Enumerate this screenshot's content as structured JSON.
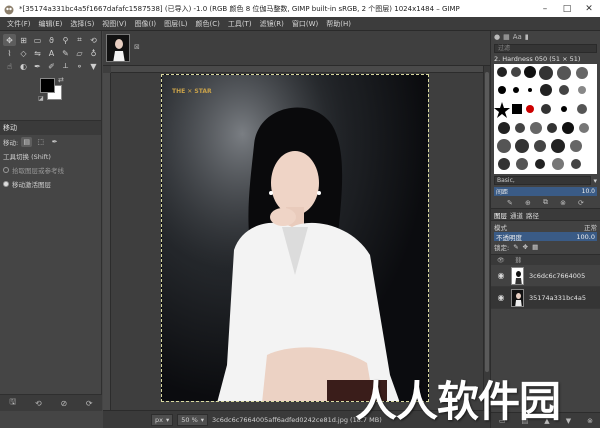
{
  "window": {
    "title": "*[35174a331bc4a5f1667dafafc1587538] (已导入) -1.0 (RGB 颜色 8 位伽马整数, GIMP built-in sRGB, 2 个图层) 1024x1484 – GIMP",
    "minimize_icon": "minimize-icon",
    "maximize_icon": "maximize-icon",
    "close_icon": "close-icon"
  },
  "menu": {
    "items": [
      "文件(F)",
      "编辑(E)",
      "选择(S)",
      "视图(V)",
      "图像(I)",
      "图层(L)",
      "颜色(C)",
      "工具(T)",
      "滤镜(R)",
      "窗口(W)",
      "帮助(H)"
    ]
  },
  "toolbox": {
    "tool_icons": [
      "move-icon",
      "align-icon",
      "rect-select-icon",
      "free-select-icon",
      "fuzzy-select-icon",
      "crop-icon",
      "transform-icon",
      "warp-icon",
      "perspective-icon",
      "flip-icon",
      "text-icon",
      "paintbrush-icon",
      "eraser-icon",
      "clone-icon",
      "smudge-icon",
      "dodge-icon",
      "path-icon",
      "color-picker-icon",
      "measure-icon",
      "zoom-icon",
      "bucket-fill-icon"
    ],
    "colors": {
      "foreground": "#000000",
      "background": "#ffffff"
    },
    "options": {
      "title": "移动",
      "move_label": "移动:",
      "tool_toggle_label": "工具切换 (Shift)",
      "option_pick": "拾取图层或参考线",
      "option_active": "移动激活图层"
    }
  },
  "canvas": {
    "watermark_logo_text": "THE STAR",
    "status": {
      "unit": "px",
      "zoom": "50 %",
      "info": "3c6dc6c7664005aff6adfed0242ce81d.jpg (18.7 MB)"
    }
  },
  "dock": {
    "filter_placeholder": "过滤",
    "brush_name": "2. Hardness 050 (51 × 51)",
    "brush_tag": "Basic,",
    "spacing_label": "间距",
    "spacing_value": "10.0",
    "tabs": {
      "layers": "图层",
      "channels": "通道",
      "paths": "路径"
    },
    "mode_label": "模式",
    "mode_value": "正常",
    "opacity_label": "不透明度",
    "opacity_value": "100.0",
    "lock_label": "锁定:",
    "layers": [
      {
        "name": "3c6dc6c7664005",
        "visible": true
      },
      {
        "name": "35174a331bc4a5",
        "visible": true
      }
    ]
  },
  "watermark": "人人软件园"
}
